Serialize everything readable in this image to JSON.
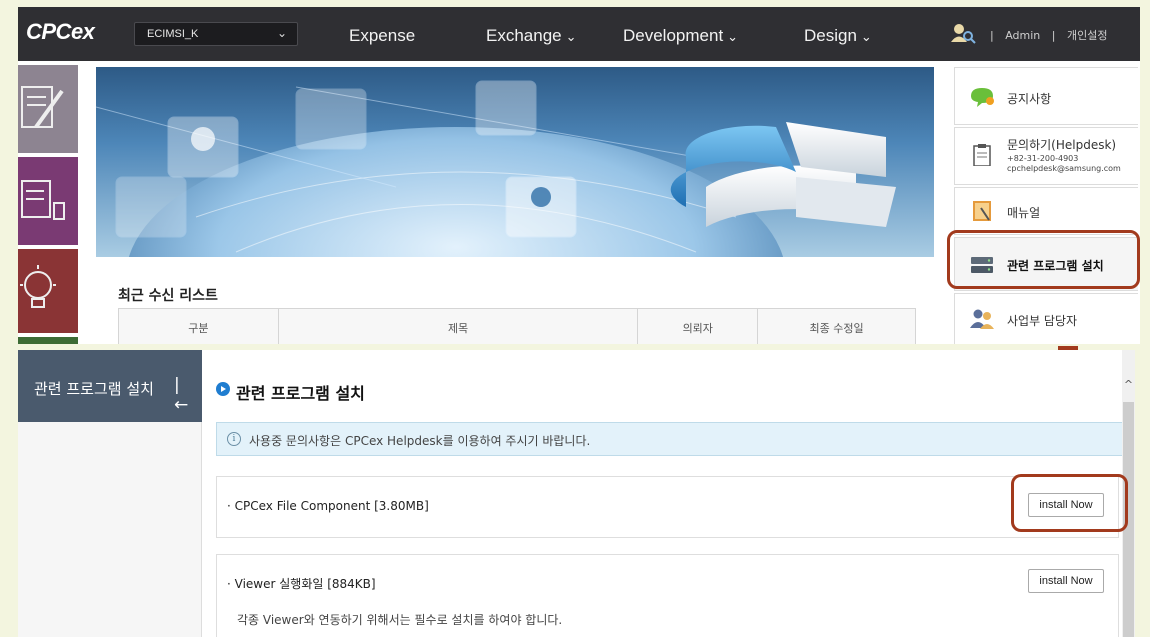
{
  "top": {
    "logo": "CPCex",
    "org_select": "ECIMSI_K",
    "nav": {
      "expense": "Expense",
      "exchange": "Exchange",
      "development": "Development",
      "design": "Design"
    },
    "admin": "Admin",
    "separator": "|",
    "personal_settings": "개인설정",
    "recent_list_title": "최근 수신 리스트",
    "table_headers": [
      "구분",
      "제목",
      "의뢰자",
      "최종 수정일"
    ],
    "right_panel": {
      "notice": "공지사항",
      "helpdesk": "문의하기(Helpdesk)",
      "helpdesk_phone": "+82-31-200-4903",
      "helpdesk_email": "cpchelpdesk@samsung.com",
      "manual": "매뉴얼",
      "install": "관련 프로그램 설치",
      "manager": "사업부 담당자"
    }
  },
  "bottom": {
    "left_title": "관련 프로그램 설치",
    "main_title": "관련 프로그램 설치",
    "info_text": "사용중 문의사항은 CPCex Helpdesk를 이용하여 주시기 바랍니다.",
    "programs": [
      {
        "name": "· CPCex File Component [3.80MB]",
        "button": "install Now"
      },
      {
        "name": "· Viewer 실행화일 [884KB]",
        "button": "install Now",
        "description": "각종 Viewer와 연동하기 위해서는 필수로 설치를 하여야 합니다."
      }
    ]
  },
  "colors": {
    "highlight": "#a23a1d",
    "topbar": "#2f2f33",
    "left_header": "#4a5a6d",
    "accent_blue": "#1f7dd0"
  }
}
